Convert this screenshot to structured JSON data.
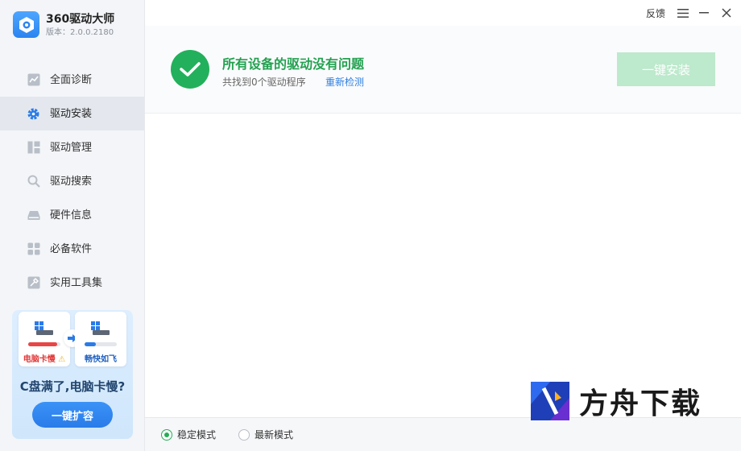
{
  "app": {
    "name": "360驱动大师",
    "version": "版本：2.0.0.2180"
  },
  "titlebar": {
    "feedback": "反馈",
    "menu_icon": "menu-icon",
    "minimize_icon": "minimize-icon",
    "close_icon": "close-icon"
  },
  "sidebar": {
    "items": [
      {
        "label": "全面诊断",
        "icon": "diagnose-icon"
      },
      {
        "label": "驱动安装",
        "icon": "gear-icon",
        "active": true
      },
      {
        "label": "驱动管理",
        "icon": "manage-icon"
      },
      {
        "label": "驱动搜索",
        "icon": "search-icon"
      },
      {
        "label": "硬件信息",
        "icon": "hardware-icon"
      },
      {
        "label": "必备软件",
        "icon": "apps-icon"
      },
      {
        "label": "实用工具集",
        "icon": "tools-icon"
      }
    ]
  },
  "promo": {
    "left_label": "电脑卡慢",
    "right_label": "畅快如飞",
    "title": "C盘满了,电脑卡慢?",
    "button": "一键扩容",
    "left_fill": 0.9,
    "right_fill": 0.35
  },
  "status": {
    "title": "所有设备的驱动没有问题",
    "subtitle": "共找到0个驱动程序",
    "rescan": "重新检测",
    "install_button": "一键安装"
  },
  "modes": {
    "stable": "稳定模式",
    "latest": "最新模式",
    "selected": "stable"
  },
  "watermark": {
    "text": "方舟下载"
  },
  "colors": {
    "accent": "#2a7be8",
    "success": "#22b05c",
    "install_disabled": "#bde9cc"
  }
}
